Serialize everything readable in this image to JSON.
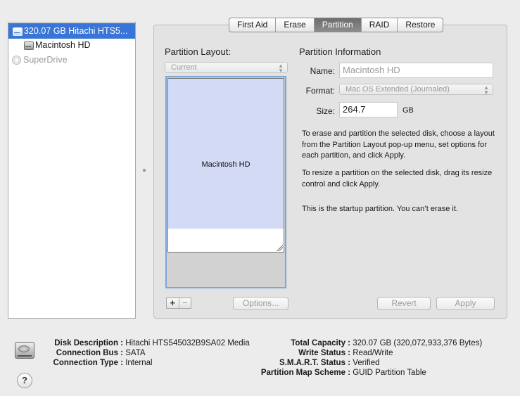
{
  "sidebar": {
    "items": [
      {
        "label": "320.07 GB Hitachi HTS5...",
        "icon": "hard-disk-icon",
        "selected": true
      },
      {
        "label": "Macintosh HD",
        "icon": "hard-disk-icon",
        "selected": false
      },
      {
        "label": "SuperDrive",
        "icon": "optical-disc-icon",
        "selected": false
      }
    ]
  },
  "tabs": [
    "First Aid",
    "Erase",
    "Partition",
    "RAID",
    "Restore"
  ],
  "active_tab": "Partition",
  "layout": {
    "heading": "Partition Layout:",
    "popup_value": "Current",
    "partition_name": "Macintosh HD",
    "options_button": "Options...",
    "add_symbol": "+",
    "remove_symbol": "−"
  },
  "info": {
    "heading": "Partition Information",
    "name_label": "Name:",
    "name_value": "Macintosh HD",
    "format_label": "Format:",
    "format_value": "Mac OS Extended (Journaled)",
    "size_label": "Size:",
    "size_value": "264.7",
    "size_unit": "GB",
    "para1": "To erase and partition the selected disk, choose a layout from the Partition Layout pop-up menu, set options for each partition, and click Apply.",
    "para2": "To resize a partition on the selected disk, drag its resize control and click Apply.",
    "para3": "This is the startup partition. You can’t erase it.",
    "revert_button": "Revert",
    "apply_button": "Apply"
  },
  "details": {
    "left": [
      {
        "key": "Disk Description :",
        "value": "Hitachi HTS545032B9SA02 Media"
      },
      {
        "key": "Connection Bus :",
        "value": "SATA"
      },
      {
        "key": "Connection Type :",
        "value": "Internal"
      }
    ],
    "right": [
      {
        "key": "Total Capacity :",
        "value": "320.07 GB (320,072,933,376 Bytes)"
      },
      {
        "key": "Write Status :",
        "value": "Read/Write"
      },
      {
        "key": "S.M.A.R.T. Status :",
        "value": "Verified"
      },
      {
        "key": "Partition Map Scheme :",
        "value": "GUID Partition Table"
      }
    ]
  },
  "help_symbol": "?",
  "colors": {
    "selection": "#3875d7",
    "partition_fill": "#d2daf6",
    "map_focus": "#7aa6d8"
  }
}
